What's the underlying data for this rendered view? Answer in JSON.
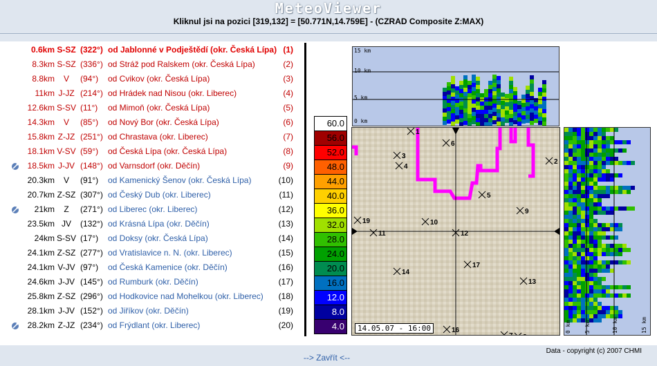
{
  "app_title": "MeteoViewer",
  "click_info": "Kliknul jsi na pozici [319,132] = [50.771N,14.759E] - (CZRAD Composite Z:MAX)",
  "towns": [
    {
      "dist": "0.6km",
      "dir": "S-SZ",
      "deg": "(322°)",
      "name": "od Jablonné v Podještědí (okr. Česká Lípa)",
      "num": "(1)",
      "color": "#e00000",
      "bold": true,
      "sat": false
    },
    {
      "dist": "8.3km",
      "dir": "S-SZ",
      "deg": "(336°)",
      "name": "od Stráž pod Ralskem (okr. Česká Lípa)",
      "num": "(2)",
      "color": "#c00000",
      "bold": false,
      "sat": false
    },
    {
      "dist": "8.8km",
      "dir": "V",
      "deg": "(94°)",
      "name": "od Cvikov (okr. Česká Lípa)",
      "num": "(3)",
      "color": "#c00000",
      "bold": false,
      "sat": false
    },
    {
      "dist": "11km",
      "dir": "J-JZ",
      "deg": "(214°)",
      "name": "od Hrádek nad Nisou (okr. Liberec)",
      "num": "(4)",
      "color": "#c00000",
      "bold": false,
      "sat": false
    },
    {
      "dist": "12.6km",
      "dir": "S-SV",
      "deg": "(11°)",
      "name": "od Mimoň (okr. Česká Lípa)",
      "num": "(5)",
      "color": "#c00000",
      "bold": false,
      "sat": false
    },
    {
      "dist": "14.3km",
      "dir": "V",
      "deg": "(85°)",
      "name": "od Nový Bor (okr. Česká Lípa)",
      "num": "(6)",
      "color": "#c00000",
      "bold": false,
      "sat": false
    },
    {
      "dist": "15.8km",
      "dir": "Z-JZ",
      "deg": "(251°)",
      "name": "od Chrastava (okr. Liberec)",
      "num": "(7)",
      "color": "#c00000",
      "bold": false,
      "sat": false
    },
    {
      "dist": "18.1km",
      "dir": "V-SV",
      "deg": "(59°)",
      "name": "od Česká Lípa (okr. Česká Lípa)",
      "num": "(8)",
      "color": "#c00000",
      "bold": false,
      "sat": false
    },
    {
      "dist": "18.5km",
      "dir": "J-JV",
      "deg": "(148°)",
      "name": "od Varnsdorf (okr. Děčín)",
      "num": "(9)",
      "color": "#c00000",
      "bold": false,
      "sat": true
    },
    {
      "dist": "20.3km",
      "dir": "V",
      "deg": "(91°)",
      "name": "od Kamenický Šenov (okr. Česká Lípa)",
      "num": "(10)",
      "color": "#000000",
      "bold": false,
      "sat": false
    },
    {
      "dist": "20.7km",
      "dir": "Z-SZ",
      "deg": "(307°)",
      "name": "od Český Dub (okr. Liberec)",
      "num": "(11)",
      "color": "#000000",
      "bold": false,
      "sat": false
    },
    {
      "dist": "21km",
      "dir": "Z",
      "deg": "(271°)",
      "name": "od Liberec (okr. Liberec)",
      "num": "(12)",
      "color": "#000000",
      "bold": false,
      "sat": true
    },
    {
      "dist": "23.5km",
      "dir": "JV",
      "deg": "(132°)",
      "name": "od Krásná Lípa (okr. Děčín)",
      "num": "(13)",
      "color": "#000000",
      "bold": false,
      "sat": false
    },
    {
      "dist": "24km",
      "dir": "S-SV",
      "deg": "(17°)",
      "name": "od Doksy (okr. Česká Lípa)",
      "num": "(14)",
      "color": "#000000",
      "bold": false,
      "sat": false
    },
    {
      "dist": "24.1km",
      "dir": "Z-SZ",
      "deg": "(277°)",
      "name": "od Vratislavice n. N. (okr. Liberec)",
      "num": "(15)",
      "color": "#000000",
      "bold": false,
      "sat": false
    },
    {
      "dist": "24.1km",
      "dir": "V-JV",
      "deg": "(97°)",
      "name": "od Česká Kamenice (okr. Děčín)",
      "num": "(16)",
      "color": "#000000",
      "bold": false,
      "sat": false
    },
    {
      "dist": "24.6km",
      "dir": "J-JV",
      "deg": "(145°)",
      "name": "od Rumburk (okr. Děčín)",
      "num": "(17)",
      "color": "#000000",
      "bold": false,
      "sat": false
    },
    {
      "dist": "25.8km",
      "dir": "Z-SZ",
      "deg": "(296°)",
      "name": "od Hodkovice nad Mohelkou (okr. Liberec)",
      "num": "(18)",
      "color": "#000000",
      "bold": false,
      "sat": false
    },
    {
      "dist": "28.1km",
      "dir": "J-JV",
      "deg": "(152°)",
      "name": "od Jiříkov (okr. Děčín)",
      "num": "(19)",
      "color": "#000000",
      "bold": false,
      "sat": false
    },
    {
      "dist": "28.2km",
      "dir": "Z-JZ",
      "deg": "(234°)",
      "name": "od Frýdlant (okr. Liberec)",
      "num": "(20)",
      "color": "#000000",
      "bold": false,
      "sat": true
    }
  ],
  "scale": [
    {
      "label": "60.0",
      "color": "#ffffff",
      "text": "#000000"
    },
    {
      "label": "56.0",
      "color": "#a00000",
      "text": "#000000"
    },
    {
      "label": "52.0",
      "color": "#ff0000",
      "text": "#000000"
    },
    {
      "label": "48.0",
      "color": "#ff6000",
      "text": "#000000"
    },
    {
      "label": "44.0",
      "color": "#ffa000",
      "text": "#000000"
    },
    {
      "label": "40.0",
      "color": "#ffd000",
      "text": "#000000"
    },
    {
      "label": "36.0",
      "color": "#ffff00",
      "text": "#000000"
    },
    {
      "label": "32.0",
      "color": "#a0e000",
      "text": "#000000"
    },
    {
      "label": "28.0",
      "color": "#30c000",
      "text": "#000000"
    },
    {
      "label": "24.0",
      "color": "#00a000",
      "text": "#000000"
    },
    {
      "label": "20.0",
      "color": "#008c50",
      "text": "#000000"
    },
    {
      "label": "16.0",
      "color": "#0070c0",
      "text": "#000000"
    },
    {
      "label": "12.0",
      "color": "#0000ff",
      "text": "#ffffff"
    },
    {
      "label": "8.0",
      "color": "#0000a0",
      "text": "#ffffff"
    },
    {
      "label": "4.0",
      "color": "#380070",
      "text": "#ffffff"
    }
  ],
  "ns_labels": [
    "15 km",
    "10 km",
    "5 km",
    "0 km"
  ],
  "ew_labels": [
    "0 km",
    "5 km",
    "10 km",
    "15 km"
  ],
  "map_points": [
    {
      "n": "1"
    },
    {
      "n": "2"
    },
    {
      "n": "3"
    },
    {
      "n": "4"
    },
    {
      "n": "5"
    },
    {
      "n": "6"
    },
    {
      "n": "7"
    },
    {
      "n": "8"
    },
    {
      "n": "9"
    },
    {
      "n": "10"
    },
    {
      "n": "11"
    },
    {
      "n": "12"
    },
    {
      "n": "13"
    },
    {
      "n": "14"
    },
    {
      "n": "16"
    },
    {
      "n": "17"
    },
    {
      "n": "19"
    }
  ],
  "timestamp": "14.05.07 - 16:00",
  "copyright": "Data - copyright (c) 2007 CHMI",
  "close_link": "--> Zavřít <--"
}
